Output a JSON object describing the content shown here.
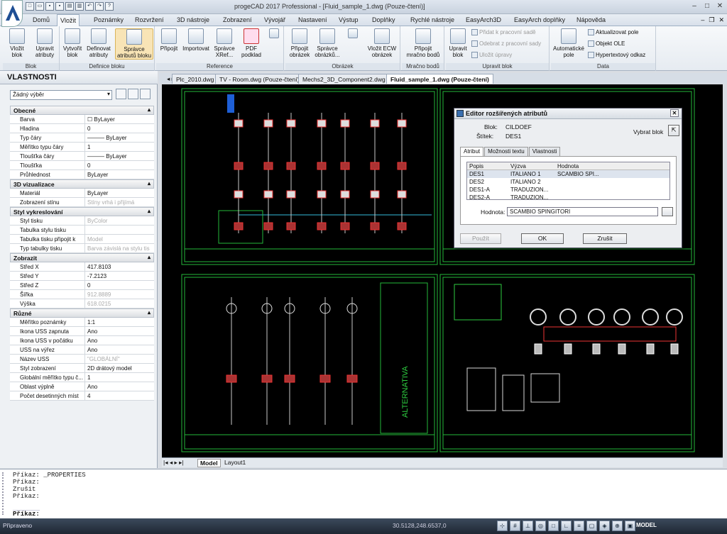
{
  "window": {
    "title": "progeCAD 2017 Professional - [Fluid_sample_1.dwg (Pouze-čtení)]"
  },
  "menu": {
    "tabs": [
      "Domů",
      "Vložit",
      "Poznámky",
      "Rozvržení",
      "3D nástroje",
      "Zobrazení",
      "Vývojář",
      "Nastavení",
      "Výstup",
      "Doplňky",
      "Rychlé nástroje",
      "EasyArch3D",
      "EasyArch doplňky",
      "Nápověda"
    ],
    "active": "Vložit"
  },
  "ribbon": {
    "groups": {
      "blok": "Blok",
      "definice": "Definice bloku",
      "reference": "Reference",
      "obrazek": "Obrázek",
      "mracno": "Mračno bodů",
      "upravit": "Upravit blok",
      "data": "Data"
    },
    "buttons": {
      "vlozit_blok": "Vložit blok",
      "upravit_atributy": "Upravit atributy",
      "vytvorit_blok": "Vytvořit blok",
      "definovat_atributy": "Definovat atributy",
      "spravce_atributu": "Správce atributů bloku",
      "pripojit": "Připojit",
      "importovat": "Importovat",
      "spravce_xref": "Správce XRef...",
      "pdf_podklad": "PDF podklad",
      "pripojit_obrazek": "Připojit obrázek",
      "spravce_obrazku": "Správce obrázků...",
      "vlozit_ecw": "Vložit ECW obrázek",
      "pripojit_mracno": "Připojit mračno bodů",
      "upravit_blok": "Upravit blok",
      "pridat_k_sade": "Přidat k pracovní sadě",
      "odebrat_ze_sady": "Odebrat z pracovní sady",
      "ulozit_upravy": "Uložit úpravy",
      "automaticke_pole": "Automatické pole",
      "aktualizovat_pole": "Aktualizovat pole",
      "objekt_ole": "Objekt OLE",
      "hypertext": "Hypertextový odkaz"
    }
  },
  "properties": {
    "title": "VLASTNOSTI",
    "selection": "Žádný výběr",
    "categories": [
      {
        "name": "Obecné",
        "rows": [
          {
            "k": "Barva",
            "v": "☐ ByLayer"
          },
          {
            "k": "Hladina",
            "v": "0"
          },
          {
            "k": "Typ čáry",
            "v": "——— ByLayer"
          },
          {
            "k": "Měřítko typu čáry",
            "v": "1"
          },
          {
            "k": "Tloušťka čáry",
            "v": "——— ByLayer"
          },
          {
            "k": "Tloušťka",
            "v": "0"
          },
          {
            "k": "Průhlednost",
            "v": "ByLayer"
          }
        ]
      },
      {
        "name": "3D vizualizace",
        "rows": [
          {
            "k": "Materiál",
            "v": "ByLayer"
          },
          {
            "k": "Zobrazení stínu",
            "v": "Stíny vrhá i přijímá",
            "dis": true
          }
        ]
      },
      {
        "name": "Styl vykreslování",
        "rows": [
          {
            "k": "Styl tisku",
            "v": "ByColor",
            "dis": true
          },
          {
            "k": "Tabulka stylu tisku",
            "v": ""
          },
          {
            "k": "Tabulka tisku připojit k",
            "v": "Model",
            "dis": true
          },
          {
            "k": "Typ tabulky tisku",
            "v": "Barva závislá na stylu tis",
            "dis": true
          }
        ]
      },
      {
        "name": "Zobrazit",
        "rows": [
          {
            "k": "Střed X",
            "v": "417.8103"
          },
          {
            "k": "Střed Y",
            "v": "-7.2123"
          },
          {
            "k": "Střed Z",
            "v": "0"
          },
          {
            "k": "Šířka",
            "v": "912.8889",
            "dis": true
          },
          {
            "k": "Výška",
            "v": "618.0215",
            "dis": true
          }
        ]
      },
      {
        "name": "Různé",
        "rows": [
          {
            "k": "Měřítko poznámky",
            "v": "1:1"
          },
          {
            "k": "Ikona USS zapnuta",
            "v": "Ano"
          },
          {
            "k": "Ikona USS v počátku",
            "v": "Ano"
          },
          {
            "k": "USS na výřez",
            "v": "Ano"
          },
          {
            "k": "Název USS",
            "v": "\"GLOBÁLNÍ\"",
            "dis": true
          },
          {
            "k": "Styl zobrazení",
            "v": "2D drátový model"
          },
          {
            "k": "Globální měřítko typu č...",
            "v": "1"
          },
          {
            "k": "Oblast výplně",
            "v": "Ano"
          },
          {
            "k": "Počet desetinných míst",
            "v": "4"
          }
        ]
      }
    ]
  },
  "docs": {
    "tabs": [
      "Plc_2010.dwg",
      "TV - Room.dwg (Pouze-čtení)",
      "Mechs2_3D_Component2.dwg",
      "Fluid_sample_1.dwg (Pouze-čtení)"
    ],
    "active_index": 3
  },
  "layout_tabs": {
    "model": "Model",
    "layout": "Layout1"
  },
  "drawing": {
    "alt_text": "ALTERNATIVA"
  },
  "dialog": {
    "title": "Editor rozšířených atributů",
    "blok_label": "Blok:",
    "blok_value": "CILDOEF",
    "stitek_label": "Štítek:",
    "stitek_value": "DES1",
    "select_block": "Vybrat blok",
    "tabs": [
      "Atribut",
      "Možnosti textu",
      "Vlastnosti"
    ],
    "columns": [
      "Popis",
      "Výzva",
      "Hodnota"
    ],
    "rows": [
      [
        "DES1",
        "ITALIANO 1",
        "SCAMBIO SPI..."
      ],
      [
        "DES2",
        "ITALIANO 2",
        ""
      ],
      [
        "DES1-A",
        "TRADUZION...",
        ""
      ],
      [
        "DES2-A",
        "TRADUZION...",
        ""
      ]
    ],
    "hodnota_label": "Hodnota:",
    "hodnota_value": "SCAMBIO SPINGITORI",
    "apply": "Použít",
    "ok": "OK",
    "cancel": "Zrušit"
  },
  "command": {
    "history": [
      "Příkaz: _PROPERTIES",
      "Příkaz:",
      "Zrušit",
      "Příkaz:"
    ],
    "prompt": "Příkaz:"
  },
  "status": {
    "left": "Připraveno",
    "coords": "30.5128,248.6537,0",
    "model": "MODEL"
  },
  "colors": {
    "accent": "#3a6fb0",
    "cad_green": "#2ecc40",
    "cad_red": "#d33"
  }
}
